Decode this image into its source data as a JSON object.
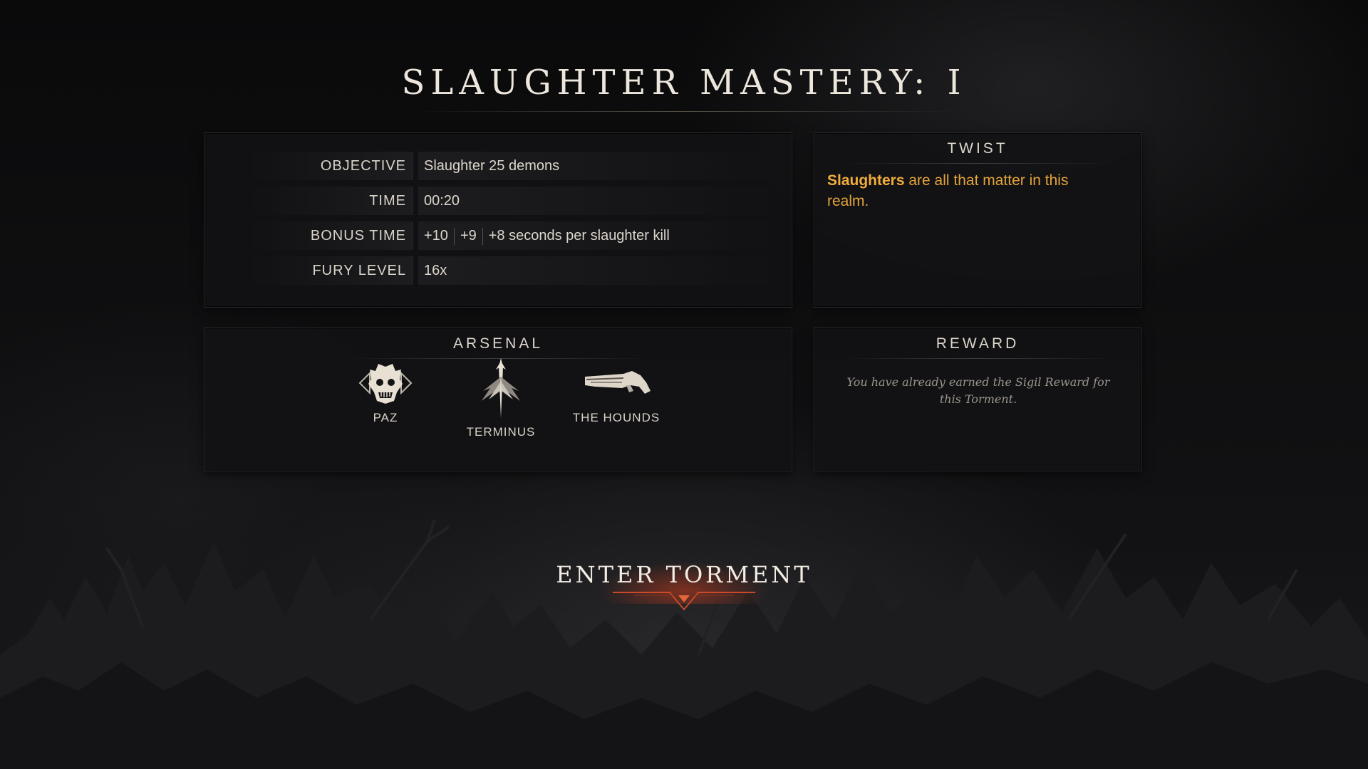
{
  "mission": {
    "title": "SLAUGHTER MASTERY: I"
  },
  "info": {
    "rows": [
      {
        "label": "OBJECTIVE",
        "value": "Slaughter 25 demons"
      },
      {
        "label": "TIME",
        "value": "00:20"
      },
      {
        "label": "BONUS TIME",
        "value_a": "+10",
        "value_b": "+9",
        "value_c": "+8 seconds per slaughter kill"
      },
      {
        "label": "FURY LEVEL",
        "value": "16x"
      }
    ]
  },
  "twist": {
    "title": "TWIST",
    "highlight": "Slaughters",
    "text": " are all that matter in this realm."
  },
  "arsenal": {
    "title": "ARSENAL",
    "weapons": [
      {
        "name": "PAZ",
        "icon": "demon-skull-icon"
      },
      {
        "name": "TERMINUS",
        "icon": "trident-icon"
      },
      {
        "name": "THE HOUNDS",
        "icon": "shotgun-icon"
      }
    ]
  },
  "reward": {
    "title": "REWARD",
    "text": "You have already earned the Sigil Reward for this Torment."
  },
  "enter": {
    "label": "ENTER TORMENT"
  },
  "colors": {
    "accent_gold": "#e3a43a",
    "accent_red": "#c83c1e",
    "text": "#ddd6cc"
  }
}
